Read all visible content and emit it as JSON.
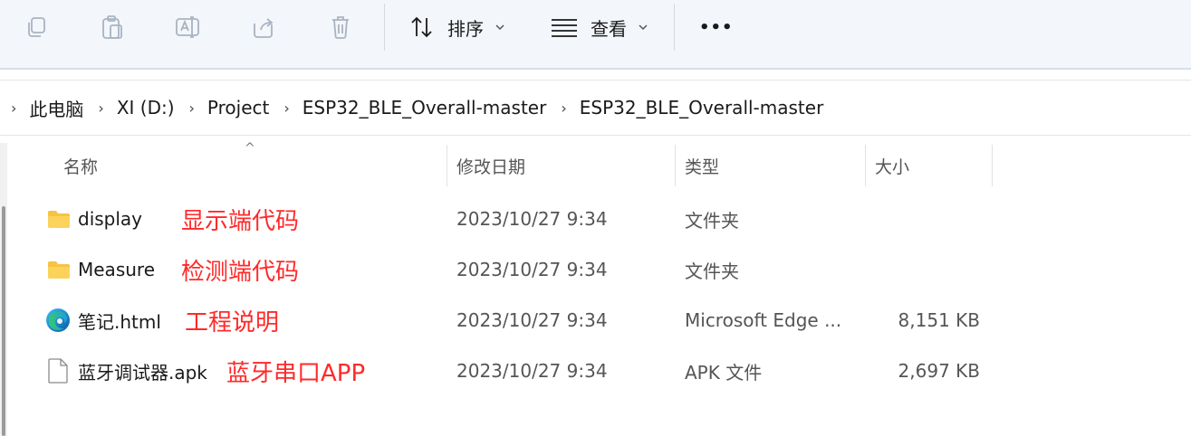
{
  "toolbar": {
    "sort_label": "排序",
    "view_label": "查看",
    "more_label": "•••"
  },
  "breadcrumb": [
    "此电脑",
    "XI (D:)",
    "Project",
    "ESP32_BLE_Overall-master",
    "ESP32_BLE_Overall-master"
  ],
  "columns": {
    "name": "名称",
    "modified": "修改日期",
    "type": "类型",
    "size": "大小"
  },
  "files": [
    {
      "name": "display",
      "icon": "folder-icon",
      "annotation": "显示端代码",
      "modified": "2023/10/27 9:34",
      "type": "文件夹",
      "size": ""
    },
    {
      "name": "Measure",
      "icon": "folder-icon",
      "annotation": "检测端代码",
      "modified": "2023/10/27 9:34",
      "type": "文件夹",
      "size": ""
    },
    {
      "name": "笔记.html",
      "icon": "edge-icon",
      "annotation": "工程说明",
      "modified": "2023/10/27 9:34",
      "type": "Microsoft Edge ...",
      "size": "8,151 KB"
    },
    {
      "name": "蓝牙调试器.apk",
      "icon": "file-icon",
      "annotation": "蓝牙串口APP",
      "modified": "2023/10/27 9:34",
      "type": "APK 文件",
      "size": "2,697 KB"
    }
  ],
  "colors": {
    "annotation": "#ff2a2a",
    "folder": "#f6c342",
    "toolbar_bg": "#f3f6fa"
  }
}
